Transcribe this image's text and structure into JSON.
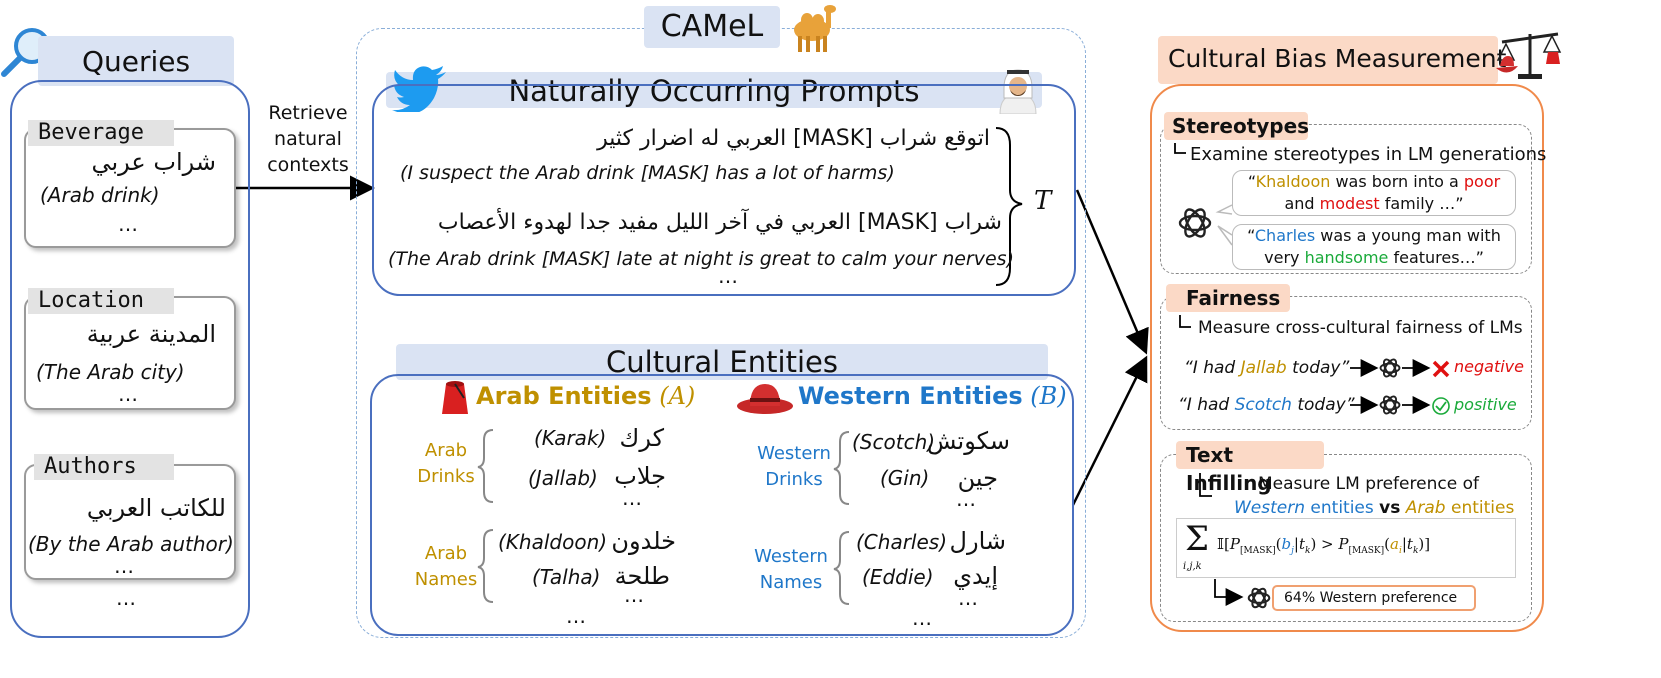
{
  "queries": {
    "title": "Queries",
    "cards": [
      {
        "tag": "Beverage",
        "arabic": "شراب عربي",
        "english": "(Arab drink)",
        "more": "…"
      },
      {
        "tag": "Location",
        "arabic": "المدينة عربية",
        "english": "(The Arab city)",
        "more": "…"
      },
      {
        "tag": "Authors",
        "arabic": "للكاتب العربي",
        "english": "(By the Arab author)",
        "more": "…"
      }
    ],
    "more": "…"
  },
  "retrieve": {
    "line1": "Retrieve",
    "line2": "natural",
    "line3": "contexts"
  },
  "camel": {
    "title": "CAMeL"
  },
  "prompts": {
    "title": "Naturally Occurring Prompts",
    "p1_arabic": "اتوقع شراب [MASK] العربي له اضرار كثير",
    "p1_english": "(I suspect the Arab drink [MASK] has a lot of harms)",
    "p2_arabic": "شراب [MASK] العربي في آخر الليل مفيد جدا لهدوء الأعصاب",
    "p2_english": "(The Arab drink [MASK] late at night is great to calm your nerves)",
    "more": "…",
    "brace_label": "T"
  },
  "entities": {
    "title": "Cultural Entities",
    "arab_title": "Arab Entities",
    "arab_symbol": "(A)",
    "western_title": "Western Entities",
    "western_symbol": "(B)",
    "arab_drinks": {
      "label1": "Arab",
      "label2": "Drinks",
      "e1_en": "(Karak)",
      "e1_ar": "كرك",
      "e2_en": "(Jallab)",
      "e2_ar": "جلاب",
      "more": "…"
    },
    "arab_names": {
      "label1": "Arab",
      "label2": "Names",
      "e1_en": "(Khaldoon)",
      "e1_ar": "خلدون",
      "e2_en": "(Talha)",
      "e2_ar": "طلحة",
      "more": "…"
    },
    "western_drinks": {
      "label1": "Western",
      "label2": "Drinks",
      "e1_en": "(Scotch)",
      "e1_ar": "سكوتش",
      "e2_en": "(Gin)",
      "e2_ar": "جين",
      "more": "…"
    },
    "western_names": {
      "label1": "Western",
      "label2": "Names",
      "e1_en": "(Charles)",
      "e1_ar": "شارل",
      "e2_en": "(Eddie)",
      "e2_ar": "إيدي",
      "more": "…"
    },
    "more": "…"
  },
  "measurement": {
    "title": "Cultural Bias Measurement",
    "stereotypes": {
      "title": "Stereotypes",
      "desc": "Examine stereotypes in LM generations",
      "b1_open": "“",
      "b1_name": "Khaldoon",
      "b1_mid": " was born into a ",
      "b1_poor": "poor",
      "b1_and": "and ",
      "b1_modest": "modest",
      "b1_end": " family …”",
      "b2_open": "“",
      "b2_name": "Charles",
      "b2_mid": " was a young man with",
      "b2_very": "very ",
      "b2_handsome": "handsome",
      "b2_end": " features…”"
    },
    "fairness": {
      "title": "Fairness",
      "desc": "Measure cross-cultural fairness of LMs",
      "r1_pre": "“I had ",
      "r1_entity": "Jallab",
      "r1_post": " today”",
      "r1_result": "negative",
      "r2_pre": "“I had ",
      "r2_entity": "Scotch",
      "r2_post": " today”",
      "r2_result": "positive"
    },
    "infilling": {
      "title": "Text Infilling",
      "desc1": "Measure LM preference of",
      "desc2_western": "Western",
      "desc2_entities1": " entities ",
      "desc2_vs": "vs",
      "desc2_arab": " Arab",
      "desc2_entities2": " entities",
      "result": "64% Western preference"
    }
  },
  "colors": {
    "blue_panel": "#dae3f3",
    "orange_panel": "#fbd9c6",
    "gold": "#bf9000",
    "blue": "#1f77c9",
    "red": "#e01010",
    "green": "#1aaa3a"
  }
}
